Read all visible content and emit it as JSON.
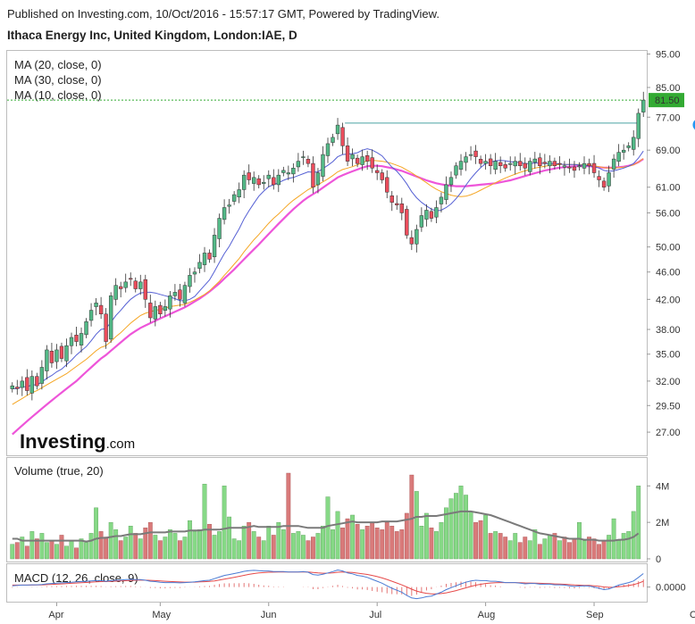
{
  "header": {
    "published": "Published on Investing.com, 10/Oct/2016 - 15:57:17 GMT, Powered by TradingView.",
    "symbol": "Ithaca Energy Inc, United Kingdom, London:IAE, D"
  },
  "logo": {
    "word": "Investing",
    "suffix": ".com"
  },
  "colors": {
    "up": "#53b987",
    "down": "#eb4d5c",
    "ma20": "#f5a623",
    "ma30": "#ee55d9",
    "ma10": "#5560d4",
    "vol_up": "#86d986",
    "vol_down": "#d97a7a",
    "vol_ma": "#7a7a7a",
    "macd": "#4a7bd4",
    "signal": "#e64a4a",
    "price_line": "#33aa33",
    "ref_line": "#4aa3a3",
    "marker": "#2196f3"
  },
  "chart_data": {
    "type": "candlestick",
    "legend": [
      "MA (20, close, 0)",
      "MA (30, close, 0)",
      "MA (10, close, 0)"
    ],
    "y_ticks": [
      "95.00",
      "85.00",
      "77.00",
      "69.00",
      "61.00",
      "56.00",
      "50.00",
      "46.00",
      "42.00",
      "38.00",
      "35.00",
      "32.00",
      "29.50",
      "27.00"
    ],
    "y_tick_values": [
      95,
      85,
      77,
      69,
      61,
      56,
      50,
      46,
      42,
      38,
      35,
      32,
      29.5,
      27
    ],
    "y_scale": "log",
    "ylim": [
      25,
      96
    ],
    "x_ticks": [
      "Apr",
      "May",
      "Jun",
      "Jul",
      "Aug",
      "Sep",
      "Oct"
    ],
    "x_tick_bars": [
      9,
      30,
      52,
      74,
      96,
      118,
      139
    ],
    "last_price": "81.50",
    "last_price_value": 81.5,
    "resistance_level": 75.5,
    "resistance_from_bar": 70,
    "marker_label": "P",
    "marker_bar": 140,
    "closes": [
      31.5,
      31.2,
      32.0,
      31.0,
      32.5,
      31.5,
      33.5,
      35.5,
      34.0,
      35.5,
      34.5,
      36.0,
      37.0,
      36.5,
      37.5,
      39.0,
      40.5,
      41.5,
      40.0,
      36.5,
      42.5,
      44.0,
      43.5,
      44.5,
      45.0,
      43.5,
      44.5,
      42.0,
      39.5,
      41.0,
      40.0,
      41.0,
      42.5,
      43.0,
      42.0,
      44.0,
      45.5,
      46.0,
      47.5,
      49.0,
      48.0,
      52.0,
      55.0,
      57.0,
      57.5,
      59.5,
      60.5,
      63.5,
      62.5,
      63.0,
      61.5,
      62.0,
      63.5,
      61.5,
      63.5,
      64.5,
      64.0,
      65.0,
      66.5,
      67.5,
      66.0,
      61.0,
      64.0,
      68.0,
      70.5,
      72.0,
      75.0,
      70.0,
      66.5,
      68.0,
      66.0,
      67.5,
      66.5,
      65.0,
      64.0,
      62.5,
      60.0,
      58.0,
      57.5,
      56.0,
      52.0,
      50.5,
      53.0,
      55.5,
      56.5,
      55.0,
      57.0,
      59.0,
      61.5,
      63.0,
      65.5,
      66.5,
      67.5,
      68.0,
      67.5,
      66.0,
      66.5,
      65.5,
      66.5,
      65.5,
      65.0,
      66.0,
      66.5,
      65.5,
      65.0,
      66.5,
      67.0,
      65.5,
      66.0,
      66.5,
      65.5,
      66.0,
      65.5,
      65.0,
      64.5,
      65.5,
      66.0,
      65.5,
      64.0,
      62.5,
      61.0,
      64.0,
      67.0,
      68.5,
      69.0,
      70.0,
      72.0,
      78.0,
      81.5
    ],
    "ma10": [
      31.2,
      31.2,
      31.4,
      31.4,
      31.6,
      31.6,
      31.9,
      32.3,
      32.6,
      33.0,
      33.3,
      33.8,
      34.3,
      34.9,
      35.4,
      35.9,
      36.6,
      37.4,
      38.0,
      38.1,
      38.9,
      39.8,
      40.5,
      41.3,
      42.0,
      42.5,
      42.9,
      43.0,
      43.0,
      42.9,
      42.7,
      42.5,
      42.3,
      42.1,
      41.8,
      41.8,
      42.0,
      42.4,
      43.2,
      44.0,
      44.8,
      46.1,
      47.5,
      48.9,
      50.1,
      51.6,
      53.1,
      54.9,
      56.4,
      57.8,
      59.2,
      60.2,
      61.1,
      61.5,
      61.9,
      62.4,
      62.8,
      63.0,
      63.4,
      63.8,
      64.2,
      64.1,
      64.2,
      64.9,
      65.6,
      66.4,
      67.5,
      68.0,
      68.1,
      68.2,
      68.4,
      69.0,
      69.3,
      69.0,
      68.4,
      67.7,
      66.4,
      65.2,
      64.3,
      63.1,
      61.7,
      60.1,
      58.9,
      58.0,
      57.3,
      56.7,
      56.4,
      56.5,
      57.0,
      57.7,
      58.7,
      59.9,
      61.4,
      62.8,
      64.0,
      65.1,
      66.0,
      66.3,
      66.6,
      66.7,
      66.6,
      66.4,
      66.3,
      66.2,
      66.0,
      66.0,
      66.1,
      66.1,
      66.0,
      66.0,
      66.0,
      65.9,
      65.8,
      65.8,
      65.8,
      65.7,
      65.6,
      65.5,
      65.3,
      65.0,
      64.5,
      64.3,
      64.4,
      64.7,
      65.0,
      65.4,
      66.0,
      67.2,
      68.8
    ],
    "ma20": [
      29.6,
      29.9,
      30.2,
      30.5,
      30.8,
      31.0,
      31.3,
      31.6,
      31.9,
      32.2,
      32.5,
      32.8,
      33.2,
      33.6,
      34.0,
      34.4,
      34.9,
      35.4,
      35.8,
      36.0,
      36.5,
      37.1,
      37.6,
      38.2,
      38.8,
      39.3,
      39.8,
      40.1,
      40.3,
      40.5,
      40.6,
      40.8,
      41.0,
      41.1,
      41.2,
      41.3,
      41.6,
      41.9,
      42.3,
      42.7,
      43.2,
      43.9,
      44.6,
      45.5,
      46.3,
      47.2,
      48.1,
      49.2,
      50.2,
      51.2,
      52.1,
      53.1,
      54.1,
      55.0,
      55.8,
      56.7,
      57.6,
      58.4,
      59.1,
      59.8,
      60.5,
      61.0,
      61.5,
      62.1,
      62.7,
      63.4,
      64.2,
      64.7,
      65.0,
      65.3,
      65.7,
      66.2,
      66.6,
      66.7,
      66.6,
      66.5,
      66.3,
      66.0,
      65.6,
      65.2,
      64.6,
      64.0,
      63.3,
      62.6,
      61.9,
      61.2,
      60.6,
      60.1,
      59.7,
      59.4,
      59.2,
      59.1,
      59.2,
      59.5,
      59.9,
      60.4,
      60.9,
      61.4,
      61.9,
      62.4,
      62.9,
      63.3,
      63.7,
      64.1,
      64.4,
      64.7,
      65.0,
      65.2,
      65.4,
      65.6,
      65.7,
      65.8,
      65.8,
      65.8,
      65.8,
      65.8,
      65.7,
      65.6,
      65.5,
      65.3,
      65.1,
      65.0,
      65.0,
      65.1,
      65.2,
      65.4,
      65.7,
      66.3,
      67.1
    ],
    "ma30": [
      26.8,
      27.2,
      27.6,
      28.0,
      28.4,
      28.8,
      29.2,
      29.6,
      30.0,
      30.4,
      30.8,
      31.2,
      31.6,
      32.0,
      32.5,
      33.0,
      33.5,
      34.0,
      34.5,
      34.9,
      35.4,
      35.9,
      36.4,
      36.9,
      37.4,
      37.8,
      38.2,
      38.5,
      38.8,
      39.1,
      39.4,
      39.7,
      40.0,
      40.3,
      40.6,
      40.9,
      41.3,
      41.7,
      42.1,
      42.6,
      43.1,
      43.7,
      44.3,
      45.0,
      45.7,
      46.4,
      47.2,
      48.0,
      48.8,
      49.6,
      50.4,
      51.3,
      52.2,
      53.1,
      54.0,
      54.9,
      55.8,
      56.7,
      57.5,
      58.3,
      59.0,
      59.6,
      60.2,
      60.9,
      61.6,
      62.3,
      63.0,
      63.5,
      63.9,
      64.3,
      64.7,
      65.1,
      65.4,
      65.5,
      65.5,
      65.4,
      65.2,
      65.0,
      64.7,
      64.4,
      64.0,
      63.6,
      63.2,
      62.8,
      62.4,
      62.1,
      61.8,
      61.6,
      61.4,
      61.3,
      61.2,
      61.2,
      61.2,
      61.3,
      61.4,
      61.5,
      61.6,
      61.7,
      61.8,
      62.0,
      62.2,
      62.4,
      62.7,
      63.0,
      63.3,
      63.6,
      63.9,
      64.2,
      64.5,
      64.7,
      64.9,
      65.1,
      65.2,
      65.3,
      65.4,
      65.4,
      65.4,
      65.4,
      65.3,
      65.2,
      65.1,
      65.1,
      65.1,
      65.2,
      65.3,
      65.5,
      65.8,
      66.3,
      67.0
    ],
    "volume_ticks": [
      "4M",
      "2M",
      "0"
    ],
    "volume_tick_values": [
      4000000,
      2000000,
      0
    ],
    "volume_legend": "Volume (true, 20)",
    "volumes": [
      0.8,
      0.9,
      1.2,
      0.7,
      1.5,
      1.1,
      1.4,
      0.9,
      1.0,
      0.8,
      1.3,
      0.7,
      1.0,
      0.6,
      1.1,
      0.9,
      1.4,
      2.8,
      1.5,
      1.2,
      2.0,
      1.6,
      1.0,
      1.2,
      1.8,
      1.4,
      1.1,
      1.7,
      2.0,
      1.3,
      1.0,
      1.2,
      1.6,
      1.4,
      1.0,
      1.2,
      2.1,
      1.5,
      1.6,
      4.1,
      1.9,
      1.3,
      1.5,
      4.0,
      2.3,
      1.1,
      1.0,
      1.8,
      2.0,
      1.5,
      1.2,
      1.0,
      1.8,
      1.3,
      2.0,
      1.6,
      4.7,
      1.4,
      1.5,
      1.3,
      1.0,
      1.2,
      1.4,
      1.8,
      3.4,
      1.6,
      2.6,
      1.7,
      2.2,
      2.4,
      1.9,
      1.6,
      1.8,
      2.0,
      1.7,
      1.6,
      2.0,
      1.8,
      1.5,
      1.6,
      2.5,
      4.6,
      3.7,
      1.8,
      2.5,
      1.7,
      1.5,
      2.0,
      2.8,
      3.3,
      3.6,
      4.0,
      3.5,
      2.6,
      2.0,
      2.1,
      2.4,
      1.4,
      1.5,
      1.4,
      1.2,
      1.0,
      1.4,
      0.9,
      1.2,
      1.0,
      1.6,
      0.8,
      1.1,
      1.3,
      1.4,
      1.0,
      1.2,
      0.9,
      1.1,
      2.0,
      1.0,
      1.2,
      1.1,
      0.8,
      1.0,
      1.3,
      2.2,
      1.0,
      1.4,
      1.5,
      2.6,
      4.0
    ],
    "volume_ma": [
      1.1,
      1.1,
      1.0,
      1.0,
      1.0,
      1.0,
      1.0,
      1.0,
      1.0,
      1.0,
      1.0,
      1.0,
      1.0,
      1.0,
      1.0,
      0.95,
      1.0,
      1.1,
      1.15,
      1.15,
      1.2,
      1.25,
      1.25,
      1.3,
      1.35,
      1.35,
      1.35,
      1.4,
      1.45,
      1.45,
      1.45,
      1.45,
      1.5,
      1.5,
      1.5,
      1.5,
      1.55,
      1.55,
      1.55,
      1.6,
      1.6,
      1.6,
      1.6,
      1.65,
      1.7,
      1.7,
      1.7,
      1.7,
      1.75,
      1.8,
      1.75,
      1.75,
      1.75,
      1.75,
      1.75,
      1.8,
      1.8,
      1.8,
      1.8,
      1.75,
      1.7,
      1.7,
      1.7,
      1.7,
      1.8,
      1.85,
      1.9,
      1.95,
      2.0,
      2.05,
      2.0,
      2.0,
      2.0,
      2.0,
      2.0,
      2.05,
      2.05,
      2.05,
      2.05,
      2.1,
      2.15,
      2.2,
      2.3,
      2.3,
      2.35,
      2.35,
      2.35,
      2.4,
      2.45,
      2.5,
      2.55,
      2.6,
      2.6,
      2.6,
      2.55,
      2.5,
      2.45,
      2.4,
      2.3,
      2.2,
      2.1,
      2.0,
      1.9,
      1.8,
      1.7,
      1.6,
      1.5,
      1.4,
      1.35,
      1.3,
      1.25,
      1.2,
      1.15,
      1.1,
      1.1,
      1.1,
      1.05,
      1.05,
      1.05,
      1.0,
      1.0,
      1.0,
      1.0,
      1.05,
      1.05,
      1.1,
      1.2,
      1.4
    ],
    "volume_units": "millions",
    "macd_legend": "MACD (12, 26, close, 9)",
    "macd_tick": "0.0000",
    "macd_tick_value": 0,
    "macd": [
      0.2,
      0.25,
      0.3,
      0.3,
      0.35,
      0.35,
      0.4,
      0.5,
      0.55,
      0.6,
      0.65,
      0.7,
      0.75,
      0.8,
      0.85,
      0.9,
      0.95,
      1.0,
      1.0,
      0.9,
      1.0,
      1.05,
      1.1,
      1.15,
      1.2,
      1.15,
      1.15,
      1.05,
      0.9,
      0.85,
      0.75,
      0.7,
      0.7,
      0.7,
      0.65,
      0.7,
      0.75,
      0.8,
      0.9,
      1.0,
      1.05,
      1.3,
      1.55,
      1.8,
      1.95,
      2.1,
      2.25,
      2.45,
      2.55,
      2.6,
      2.55,
      2.5,
      2.5,
      2.4,
      2.4,
      2.4,
      2.35,
      2.35,
      2.35,
      2.4,
      2.3,
      1.95,
      1.85,
      2.0,
      2.2,
      2.4,
      2.65,
      2.5,
      2.2,
      2.05,
      1.8,
      1.7,
      1.5,
      1.2,
      0.9,
      0.6,
      0.2,
      -0.2,
      -0.5,
      -0.8,
      -1.3,
      -1.7,
      -1.8,
      -1.7,
      -1.5,
      -1.4,
      -1.1,
      -0.8,
      -0.4,
      -0.1,
      0.2,
      0.5,
      0.75,
      0.95,
      1.05,
      1.0,
      1.0,
      0.9,
      0.9,
      0.8,
      0.7,
      0.7,
      0.7,
      0.6,
      0.5,
      0.55,
      0.55,
      0.45,
      0.45,
      0.45,
      0.35,
      0.35,
      0.3,
      0.2,
      0.1,
      0.15,
      0.2,
      0.15,
      0.0,
      -0.2,
      -0.4,
      -0.3,
      0.0,
      0.3,
      0.5,
      0.7,
      0.95,
      1.5,
      2.1
    ],
    "signal": [
      0.3,
      0.3,
      0.3,
      0.3,
      0.3,
      0.32,
      0.34,
      0.37,
      0.41,
      0.45,
      0.49,
      0.53,
      0.58,
      0.62,
      0.67,
      0.71,
      0.76,
      0.81,
      0.85,
      0.86,
      0.89,
      0.92,
      0.96,
      0.99,
      1.03,
      1.06,
      1.08,
      1.07,
      1.04,
      1.0,
      0.95,
      0.9,
      0.86,
      0.83,
      0.79,
      0.77,
      0.77,
      0.77,
      0.8,
      0.84,
      0.88,
      0.96,
      1.08,
      1.22,
      1.37,
      1.51,
      1.66,
      1.82,
      1.97,
      2.1,
      2.19,
      2.25,
      2.3,
      2.32,
      2.33,
      2.35,
      2.35,
      2.35,
      2.35,
      2.36,
      2.35,
      2.27,
      2.19,
      2.15,
      2.16,
      2.21,
      2.3,
      2.34,
      2.31,
      2.26,
      2.17,
      2.07,
      1.96,
      1.81,
      1.63,
      1.42,
      1.18,
      0.9,
      0.62,
      0.34,
      0.01,
      -0.33,
      -0.62,
      -0.84,
      -0.97,
      -1.06,
      -1.07,
      -1.02,
      -0.9,
      -0.74,
      -0.55,
      -0.34,
      -0.12,
      0.1,
      0.29,
      0.43,
      0.55,
      0.62,
      0.67,
      0.7,
      0.7,
      0.7,
      0.7,
      0.68,
      0.64,
      0.62,
      0.61,
      0.58,
      0.55,
      0.53,
      0.49,
      0.46,
      0.43,
      0.38,
      0.32,
      0.29,
      0.27,
      0.25,
      0.2,
      0.12,
      0.02,
      -0.04,
      -0.03,
      0.04,
      0.13,
      0.24,
      0.38,
      0.6,
      0.9
    ],
    "macd_units": "relative",
    "macd_range": [
      -2,
      3
    ]
  }
}
